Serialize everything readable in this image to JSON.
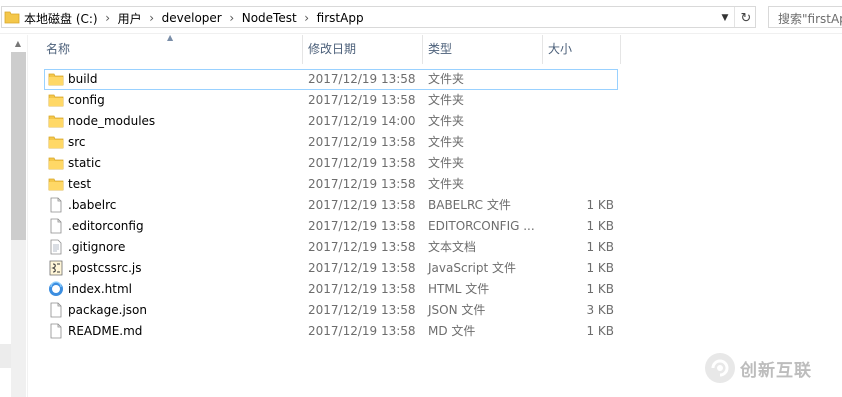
{
  "address_bar": {
    "icon": "folder-icon",
    "breadcrumbs": [
      "本地磁盘 (C:)",
      "用户",
      "developer",
      "NodeTest",
      "firstApp"
    ],
    "dropdown_icon": "chevron-down-icon",
    "refresh_icon": "refresh-icon"
  },
  "search": {
    "placeholder": "搜索\"firstApp\""
  },
  "columns": {
    "name": "名称",
    "date": "修改日期",
    "type": "类型",
    "size": "大小"
  },
  "files": [
    {
      "name": "build",
      "date": "2017/12/19 13:58",
      "type": "文件夹",
      "size": "",
      "icon": "folder-icon",
      "selected": true
    },
    {
      "name": "config",
      "date": "2017/12/19 13:58",
      "type": "文件夹",
      "size": "",
      "icon": "folder-icon"
    },
    {
      "name": "node_modules",
      "date": "2017/12/19 14:00",
      "type": "文件夹",
      "size": "",
      "icon": "folder-icon"
    },
    {
      "name": "src",
      "date": "2017/12/19 13:58",
      "type": "文件夹",
      "size": "",
      "icon": "folder-icon"
    },
    {
      "name": "static",
      "date": "2017/12/19 13:58",
      "type": "文件夹",
      "size": "",
      "icon": "folder-icon"
    },
    {
      "name": "test",
      "date": "2017/12/19 13:58",
      "type": "文件夹",
      "size": "",
      "icon": "folder-icon"
    },
    {
      "name": ".babelrc",
      "date": "2017/12/19 13:58",
      "type": "BABELRC 文件",
      "size": "1 KB",
      "icon": "file-icon"
    },
    {
      "name": ".editorconfig",
      "date": "2017/12/19 13:58",
      "type": "EDITORCONFIG ...",
      "size": "1 KB",
      "icon": "file-icon"
    },
    {
      "name": ".gitignore",
      "date": "2017/12/19 13:58",
      "type": "文本文档",
      "size": "1 KB",
      "icon": "text-file-icon"
    },
    {
      "name": ".postcssrc.js",
      "date": "2017/12/19 13:58",
      "type": "JavaScript 文件",
      "size": "1 KB",
      "icon": "script-file-icon"
    },
    {
      "name": "index.html",
      "date": "2017/12/19 13:58",
      "type": "HTML 文件",
      "size": "1 KB",
      "icon": "browser-file-icon"
    },
    {
      "name": "package.json",
      "date": "2017/12/19 13:58",
      "type": "JSON 文件",
      "size": "3 KB",
      "icon": "file-icon"
    },
    {
      "name": "README.md",
      "date": "2017/12/19 13:58",
      "type": "MD 文件",
      "size": "1 KB",
      "icon": "file-icon"
    }
  ],
  "watermark": {
    "text": "创新互联",
    "icon": "brand-logo-icon"
  },
  "colors": {
    "header_text": "#4c607a",
    "secondary_text": "#6d6d6d",
    "selection_border": "#99d1ff",
    "folder_yellow": "#f4c74a",
    "watermark_gray": "#bdbdbd"
  }
}
